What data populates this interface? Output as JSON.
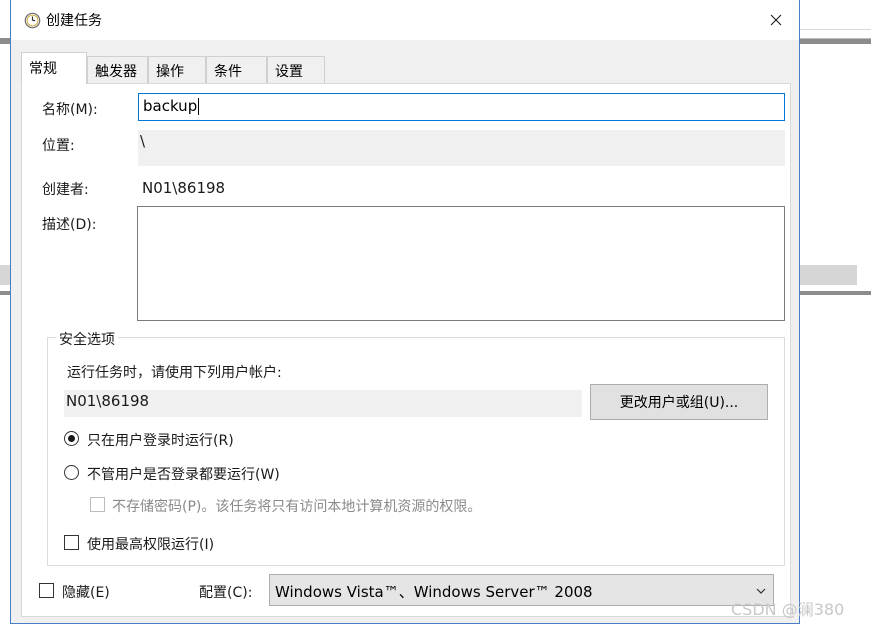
{
  "window": {
    "title": "创建任务",
    "icon": "clock-icon",
    "close_icon": "close-icon"
  },
  "tabs": [
    {
      "label": "常规",
      "active": true
    },
    {
      "label": "触发器",
      "active": false
    },
    {
      "label": "操作",
      "active": false
    },
    {
      "label": "条件",
      "active": false
    },
    {
      "label": "设置",
      "active": false
    }
  ],
  "general": {
    "name_label": "名称(M):",
    "name_value": "backup",
    "location_label": "位置:",
    "location_value": "\\",
    "author_label": "创建者:",
    "author_value": "N01\\86198",
    "description_label": "描述(D):",
    "description_value": ""
  },
  "security": {
    "group_title": "安全选项",
    "run_as_text": "运行任务时，请使用下列用户帐户:",
    "user_account": "N01\\86198",
    "change_user_button": "更改用户或组(U)...",
    "radio_logged_on": "只在用户登录时运行(R)",
    "radio_whether_logged_on": "不管用户是否登录都要运行(W)",
    "radio_selected": "logged_on",
    "no_store_password": "不存储密码(P)。该任务将只有访问本地计算机资源的权限。",
    "highest_privileges": "使用最高权限运行(I)"
  },
  "footer": {
    "hidden_label": "隐藏(E)",
    "configure_label": "配置(C):",
    "configure_value": "Windows Vista™、Windows Server™ 2008"
  },
  "watermark": "CSDN @澜380",
  "colors": {
    "accent": "#0078d7",
    "dialog_bg": "#f0f0f0",
    "border_blue": "#4a7ec4"
  }
}
